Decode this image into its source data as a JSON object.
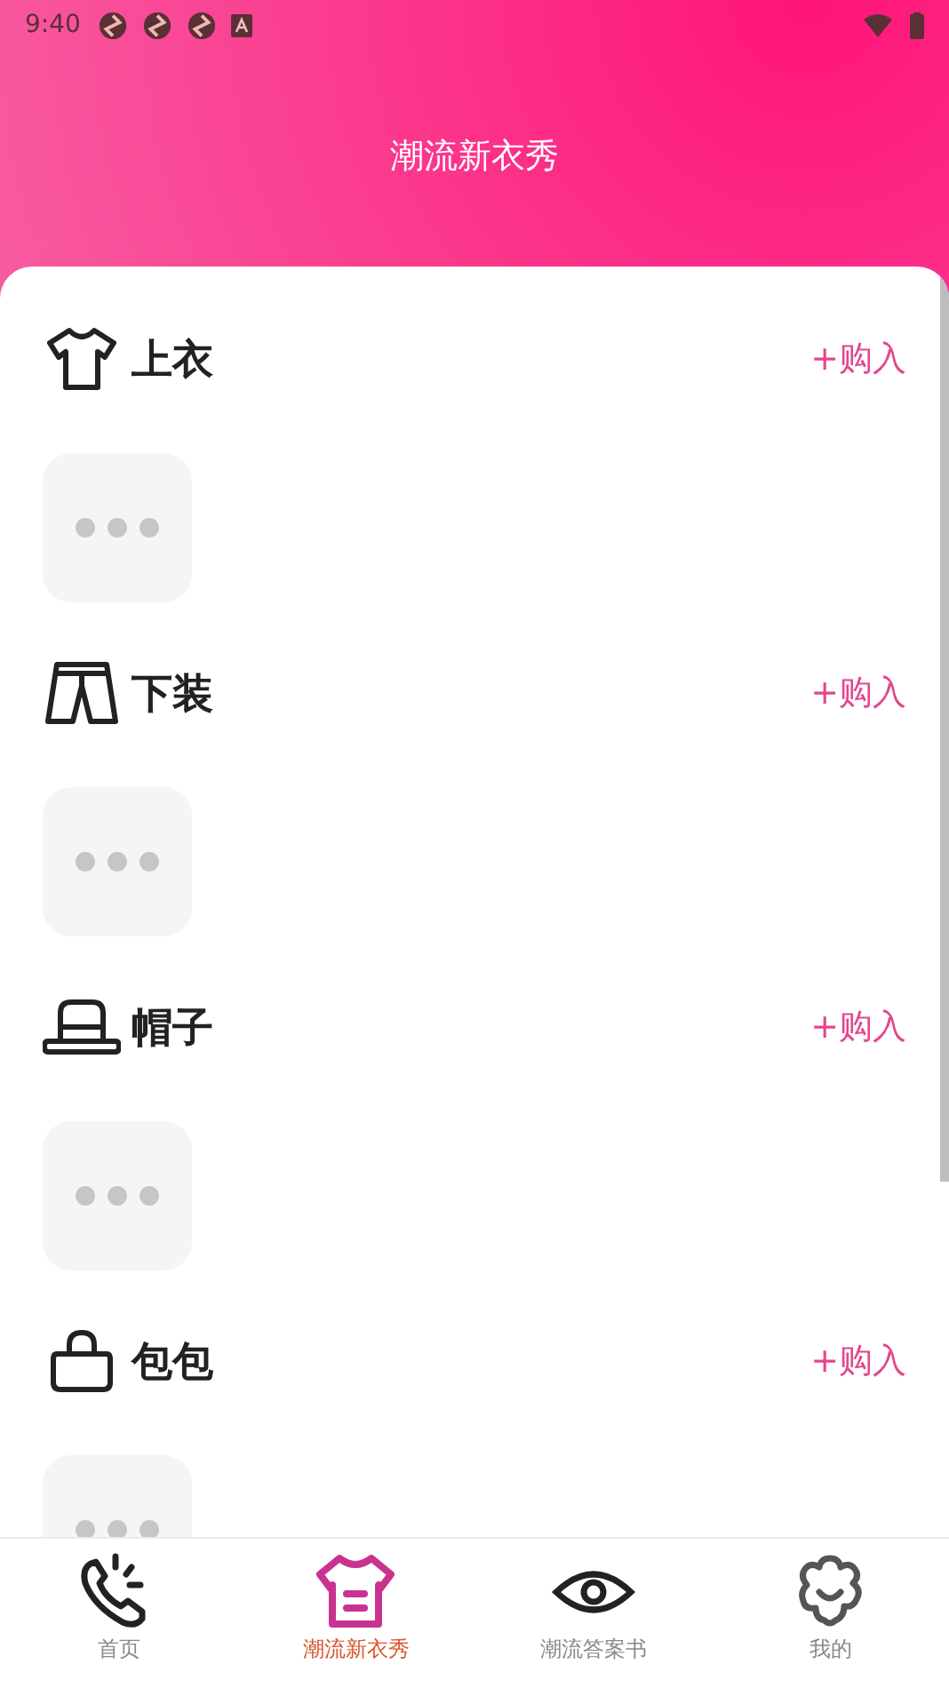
{
  "status_bar": {
    "time": "9:40"
  },
  "header": {
    "title": "潮流新衣秀"
  },
  "sections": [
    {
      "kind": "shirt",
      "title": "上衣",
      "action": "+购入"
    },
    {
      "kind": "pants",
      "title": "下装",
      "action": "+购入"
    },
    {
      "kind": "hat",
      "title": "帽子",
      "action": "+购入"
    },
    {
      "kind": "bag",
      "title": "包包",
      "action": "+购入"
    }
  ],
  "bottom_nav": [
    {
      "kind": "phone",
      "label": "首页",
      "selected": false
    },
    {
      "kind": "shirt",
      "label": "潮流新衣秀",
      "selected": true
    },
    {
      "kind": "eye",
      "label": "潮流答案书",
      "selected": false
    },
    {
      "kind": "flower",
      "label": "我的",
      "selected": false
    }
  ]
}
